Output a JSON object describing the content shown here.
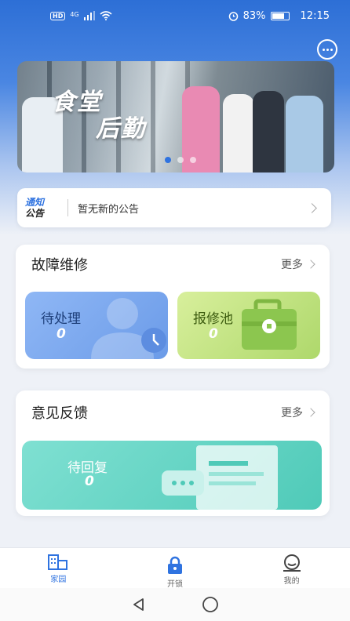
{
  "status_bar": {
    "network": "HD",
    "signal": "4G",
    "battery": "83%",
    "time": "12:15"
  },
  "banner": {
    "title_line1": "食堂",
    "title_line2": "后勤",
    "active_dot": 0,
    "dot_count": 3
  },
  "notice": {
    "logo_top": "通知",
    "logo_bottom": "公告",
    "text": "暂无新的公告"
  },
  "repair": {
    "title": "故障维修",
    "more": "更多",
    "pending_label": "待处理",
    "pending_count": "0",
    "pool_label": "报修池",
    "pool_count": "0"
  },
  "feedback": {
    "title": "意见反馈",
    "more": "更多",
    "reply_label": "待回复",
    "reply_count": "0"
  },
  "bottom_nav": {
    "items": [
      {
        "label": "家园",
        "icon": "building-icon"
      },
      {
        "label": "开锁",
        "icon": "lock-icon"
      },
      {
        "label": "我的",
        "icon": "user-icon"
      }
    ],
    "active_index": 0
  },
  "colors": {
    "accent": "#2f73e0",
    "pending_tile": "#7ca8ef",
    "pool_tile": "#bfe27f",
    "reply_tile": "#5fd3c2"
  }
}
